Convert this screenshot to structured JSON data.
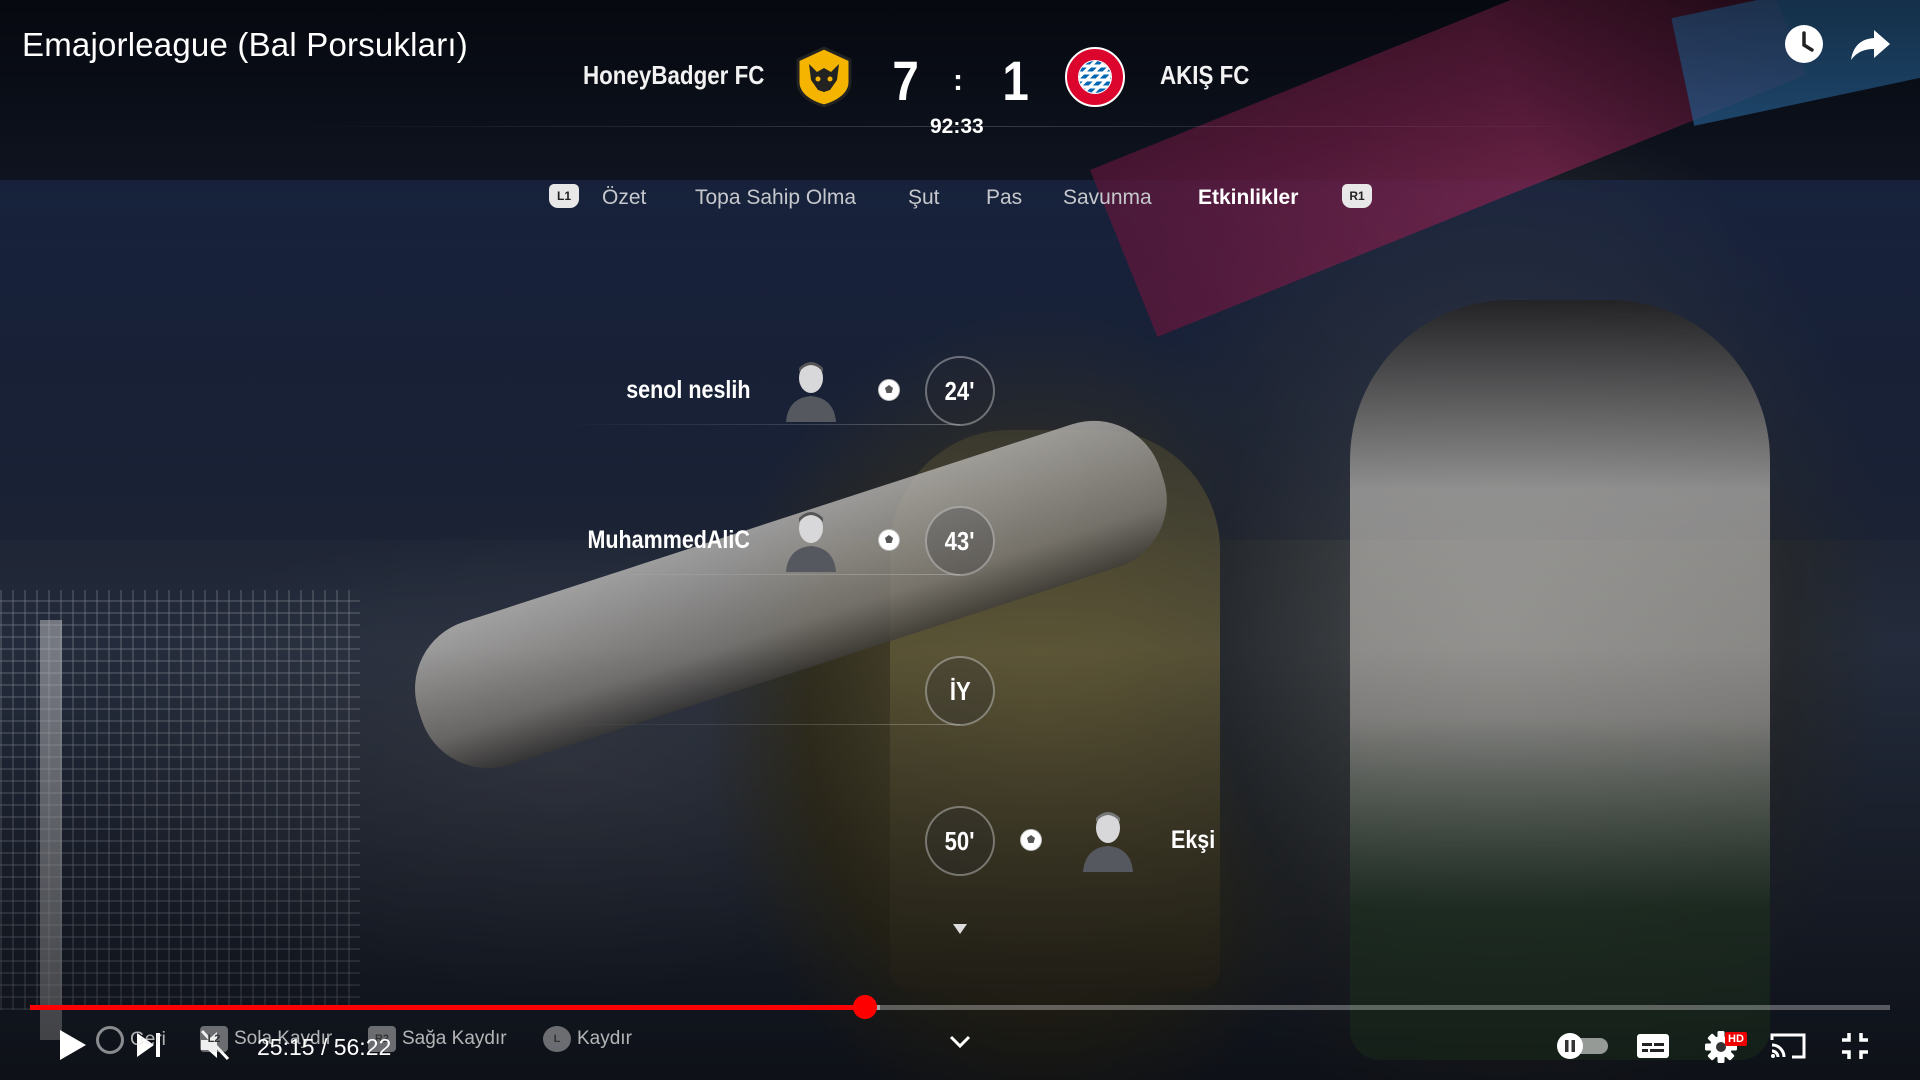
{
  "video": {
    "title": "Emajorleague (Bal Porsukları)",
    "current_time": "25:15",
    "duration": "56:22",
    "time_display": "25:15 / 56:22",
    "progress": 0.449,
    "buffered": 0.457
  },
  "top_actions": {
    "watch_later_icon": "clock-icon",
    "share_icon": "share-arrow-icon"
  },
  "scoreboard": {
    "home_team": "HoneyBadger FC",
    "away_team": "AKIŞ FC",
    "home_score": "7",
    "away_score": "1",
    "separator": ":",
    "clock": "92:33",
    "home_crest_icon": "wolf-crest-icon",
    "away_crest_icon": "bayern-crest-icon",
    "away_crest_text": "FC BAYERN MÜNCHEN"
  },
  "tabs": {
    "left_bumper": "L1",
    "right_bumper": "R1",
    "items": [
      {
        "label": "Özet"
      },
      {
        "label": "Topa Sahip Olma"
      },
      {
        "label": "Şut"
      },
      {
        "label": "Pas"
      },
      {
        "label": "Savunma"
      },
      {
        "label": "Etkinlikler",
        "active": true
      }
    ]
  },
  "events": [
    {
      "side": "home",
      "player": "senol neslih",
      "minute": "24'",
      "type": "goal-ball-icon"
    },
    {
      "side": "home",
      "player": "MuhammedAliC",
      "minute": "43'",
      "type": "goal-ball-icon"
    },
    {
      "side": "marker",
      "label": "İY"
    },
    {
      "side": "away",
      "player": "Ekşi",
      "minute": "50'",
      "type": "goal-ball-icon"
    }
  ],
  "controller_hints": {
    "back": "Geri",
    "scroll_left": "Sola Kaydır",
    "scroll_right": "Sağa Kaydır",
    "scroll": "Kaydır",
    "scroll_left_key": "L2",
    "scroll_right_key": "R2",
    "scroll_key": "L"
  },
  "player_controls": {
    "play_icon": "play-icon",
    "next_icon": "next-icon",
    "mute_icon": "muted-volume-icon",
    "chevron_icon": "chevron-down-icon",
    "autoplay_icon": "autoplay-toggle-icon",
    "captions_icon": "captions-icon",
    "settings_icon": "gear-icon",
    "quality_badge": "HD",
    "cast_icon": "cast-icon",
    "exit_fullscreen_icon": "exit-fullscreen-icon"
  },
  "colors": {
    "progress": "#ff0000",
    "active_tab": "#ffffff",
    "inactive_tab": "#c6c8cc",
    "home_crest": "#f4b400",
    "away_crest": "#dc052d"
  }
}
